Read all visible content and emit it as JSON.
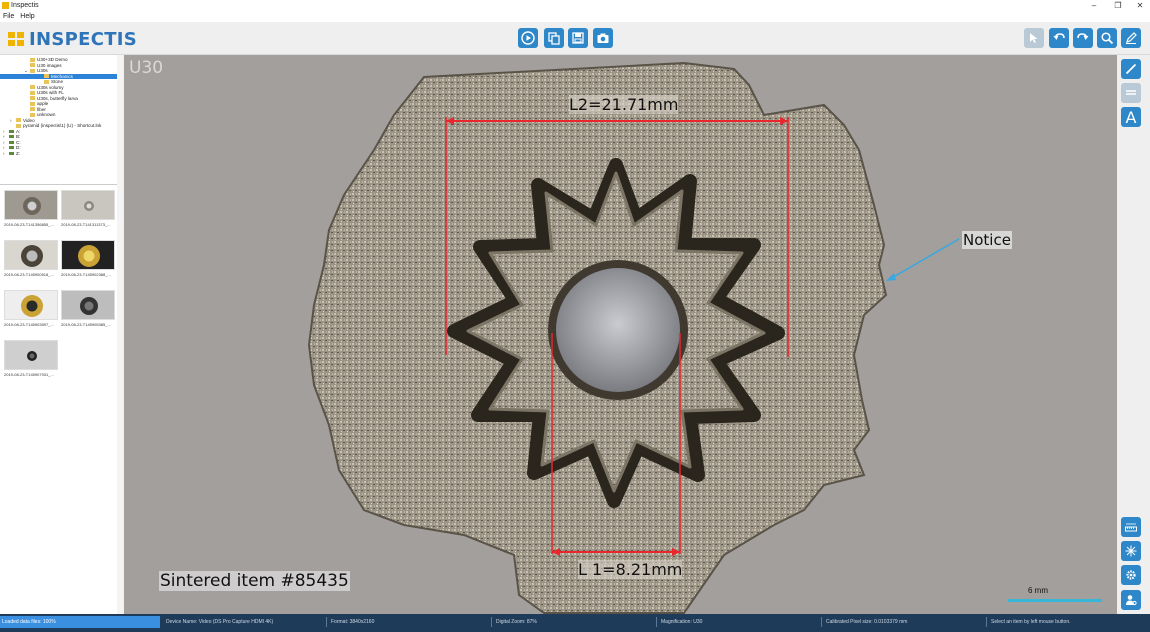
{
  "window": {
    "title": "Inspectis",
    "minimize": "–",
    "maximize": "❐",
    "close": "✕"
  },
  "menu": {
    "items": [
      "File",
      "Help"
    ]
  },
  "toolbar": {
    "logo": "INSPECTIS",
    "center_buttons": [
      "play-icon",
      "copy-icon",
      "save-icon",
      "camera-icon"
    ],
    "right_buttons": [
      "select-icon",
      "undo-icon",
      "redo-icon",
      "zoom-icon",
      "pen-icon"
    ]
  },
  "tree": {
    "items": [
      {
        "label": "U30+3D Demo",
        "indent": 4,
        "type": "folder"
      },
      {
        "label": "U30 images",
        "indent": 4,
        "type": "folder"
      },
      {
        "label": "U30s",
        "indent": 4,
        "type": "folder",
        "expander": "⌄"
      },
      {
        "label": "Mechanics",
        "indent": 6,
        "type": "folder",
        "selected": true
      },
      {
        "label": "Stone",
        "indent": 6,
        "type": "folder"
      },
      {
        "label": "U30s volumy",
        "indent": 4,
        "type": "folder"
      },
      {
        "label": "U30s with FL",
        "indent": 4,
        "type": "folder"
      },
      {
        "label": "U30s, butterfly larva",
        "indent": 4,
        "type": "folder"
      },
      {
        "label": "apple",
        "indent": 4,
        "type": "folder"
      },
      {
        "label": "fiber",
        "indent": 4,
        "type": "folder"
      },
      {
        "label": "unknown",
        "indent": 4,
        "type": "folder"
      },
      {
        "label": "Video",
        "indent": 2,
        "type": "folder",
        "expander": "›"
      },
      {
        "label": "pyramid (inspectis\\1) (U) - Shortcut.lnk",
        "indent": 2,
        "type": "folder"
      },
      {
        "label": "A:",
        "indent": 1,
        "type": "drive",
        "expander": "›"
      },
      {
        "label": "B:",
        "indent": 1,
        "type": "drive",
        "expander": "›"
      },
      {
        "label": "C:",
        "indent": 1,
        "type": "drive",
        "expander": "›"
      },
      {
        "label": "D:",
        "indent": 1,
        "type": "drive",
        "expander": "›"
      },
      {
        "label": "Z:",
        "indent": 1,
        "type": "drive",
        "expander": "›"
      }
    ]
  },
  "thumbnails": [
    {
      "label": "2019-08-23-T141356855_...",
      "style": "gear-gray"
    },
    {
      "label": "2019-08-23-T141311373_...",
      "style": "gear-small"
    },
    {
      "label": "2019-08-23-T145900518_...",
      "style": "gear-dark"
    },
    {
      "label": "2019-08-23-T145902388_...",
      "style": "bearing-gold"
    },
    {
      "label": "2019-08-23-T145903597_...",
      "style": "bearing-gold2"
    },
    {
      "label": "2019-08-23-T145905385_...",
      "style": "bearing-dark"
    },
    {
      "label": "2019-08-23-T145907931_...",
      "style": "bearing-small"
    }
  ],
  "viewer": {
    "label": "U30",
    "measurements": [
      {
        "label": "L2=21.71mm"
      },
      {
        "label": "L 1=8.21mm"
      }
    ],
    "annotation": "Notice",
    "caption": "Sintered item #85435",
    "scale": "6 mm",
    "colors": {
      "measure": "#e8262b",
      "arrow": "#38a8e0",
      "background": "#a29f9d"
    }
  },
  "right_tools": {
    "top": [
      "line-icon",
      "hline-icon",
      "text-icon"
    ],
    "bottom": [
      "ruler-icon",
      "center-icon",
      "gear-settings-icon",
      "person-settings-icon"
    ],
    "text_tool_glyph": "A"
  },
  "statusbar": {
    "loaded": "Loaded data files: 100%",
    "device": "Device Name: Video (DS Pro Capture HDMI 4K)",
    "format": "Format: 3840x2160",
    "zoom": "Digital Zoom: 87%",
    "magnification": "Magnification: U30",
    "pixel": "Calibrated Pixel size: 0.0103379 mm",
    "hint": "Select an item by left mouse button."
  }
}
